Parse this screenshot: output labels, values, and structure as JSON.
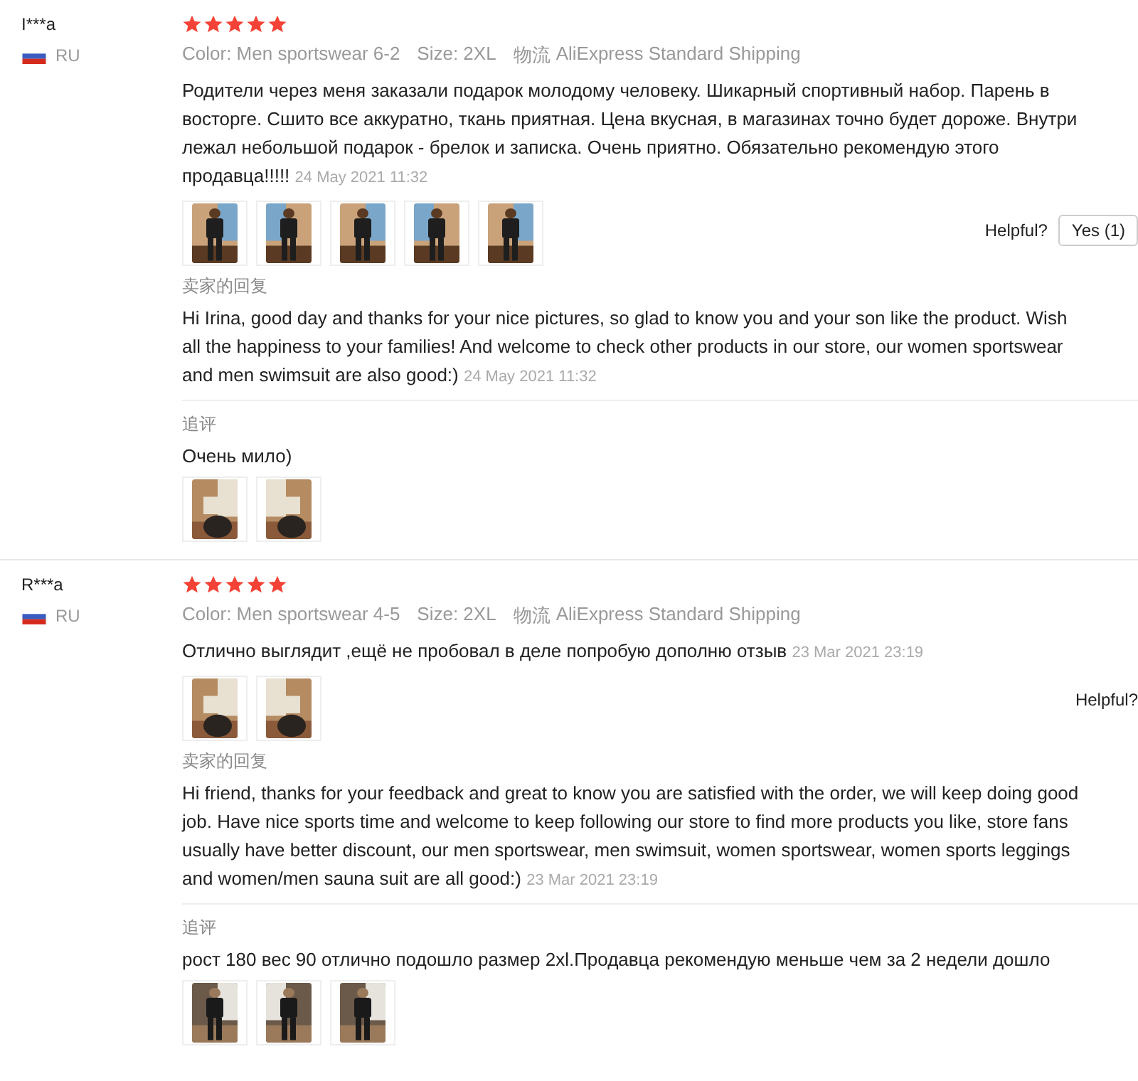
{
  "reviews": [
    {
      "name": "I***a",
      "country": "RU",
      "stars": 5,
      "meta": {
        "variant": "Color: Men sportswear 6-2",
        "size": "Size: 2XL",
        "shipping_label": "物流",
        "shipping": "AliExpress Standard Shipping"
      },
      "text": "Родители через меня заказали подарок молодому человеку. Шикарный спортивный набор. Парень в восторге. Сшито все аккуратно, ткань приятная. Цена вкусная, в магазинах точно будет дороже. Внутри лежал небольшой подарок - брелок и записка. Очень приятно. Обязательно рекомендую этого продавца!!!!!",
      "date": "24 May 2021 11:32",
      "photos": [
        {
          "kind": "picture"
        },
        {
          "kind": "picture"
        },
        {
          "kind": "picture"
        },
        {
          "kind": "picture"
        },
        {
          "kind": "picture"
        }
      ],
      "helpful": {
        "label": "Helpful?",
        "button": "Yes (1)"
      },
      "reply": {
        "label": "卖家的回复",
        "text": "Hi Irina, good day and thanks for your nice pictures, so glad to know you and your son like the product. Wish all the happiness to your families! And welcome to check other products in our store, our women sportswear and men swimsuit are also good:)",
        "date": "24 May 2021 11:32"
      },
      "followup": {
        "label": "追评",
        "text": "Очень мило)",
        "photos": [
          {
            "kind": "picture"
          },
          {
            "kind": "picture"
          }
        ]
      }
    },
    {
      "name": "R***a",
      "country": "RU",
      "stars": 5,
      "meta": {
        "variant": "Color: Men sportswear 4-5",
        "size": "Size: 2XL",
        "shipping_label": "物流",
        "shipping": "AliExpress Standard Shipping"
      },
      "text": "Отлично выглядит ,ещё не пробовал в деле попробую дополню отзыв",
      "date": "23 Mar 2021 23:19",
      "photos": [
        {
          "kind": "picture"
        },
        {
          "kind": "picture"
        }
      ],
      "helpful": {
        "label": "Helpful?"
      },
      "reply": {
        "label": "卖家的回复",
        "text": "Hi friend, thanks for your feedback and great to know you are satisfied with the order, we will keep doing good job. Have nice sports time and welcome to keep following our store to find more products you like, store fans usually have better discount, our men sportswear, men swimsuit, women sportswear, women sports leggings and women/men sauna suit are all good:)",
        "date": "23 Mar 2021 23:19"
      },
      "followup": {
        "label": "追评",
        "text": "рост 180 вес 90 отлично подошло размер 2xl.Продавца рекомендую меньше чем за 2 недели дошло",
        "photos": [
          {
            "kind": "picture"
          },
          {
            "kind": "picture"
          },
          {
            "kind": "picture"
          }
        ]
      }
    }
  ]
}
